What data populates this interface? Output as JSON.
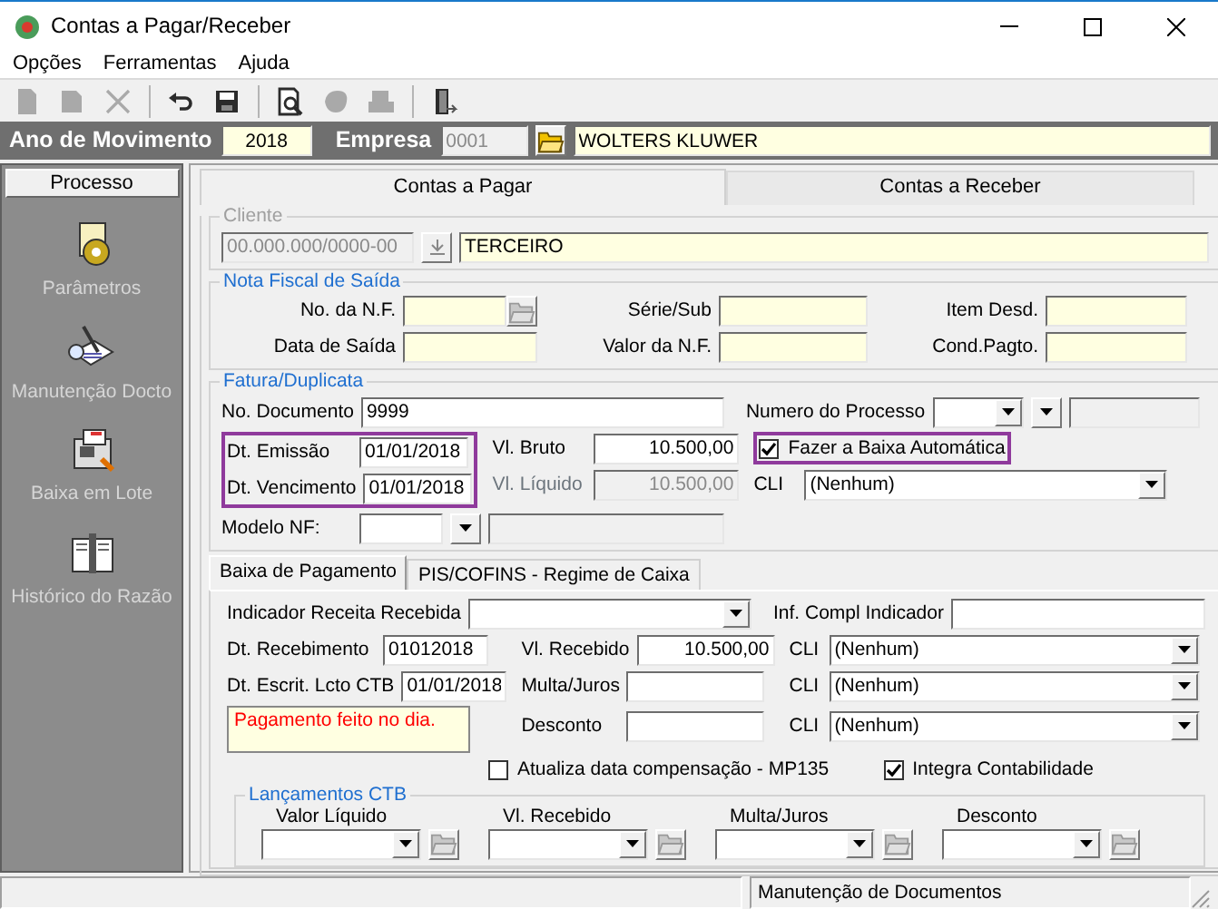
{
  "window": {
    "title": "Contas a Pagar/Receber"
  },
  "menu": [
    {
      "label": "Opções"
    },
    {
      "label": "Ferramentas"
    },
    {
      "label": "Ajuda"
    }
  ],
  "toolbar": [
    {
      "kind": "new",
      "disabled": true
    },
    {
      "kind": "edit",
      "disabled": true
    },
    {
      "kind": "delete",
      "disabled": true
    },
    {
      "kind": "undo",
      "disabled": false
    },
    {
      "kind": "save",
      "disabled": false
    },
    {
      "kind": "preview",
      "disabled": false
    },
    {
      "kind": "shape",
      "disabled": true
    },
    {
      "kind": "machine",
      "disabled": true
    },
    {
      "kind": "exit",
      "disabled": false
    }
  ],
  "header": {
    "year_label": "Ano de Movimento",
    "year": "2018",
    "company_label": "Empresa",
    "company_code": "0001",
    "company_name": "WOLTERS KLUWER"
  },
  "sidebar": {
    "title": "Processo",
    "items": [
      {
        "kind": "gear",
        "label": "Parâmetros"
      },
      {
        "kind": "pen",
        "label": "Manutenção Docto"
      },
      {
        "kind": "machine",
        "label": "Baixa em Lote"
      },
      {
        "kind": "book",
        "label": "Histórico do Razão"
      }
    ]
  },
  "tabs": [
    {
      "label": "Contas a Pagar",
      "selected": true
    },
    {
      "label": "Contas a Receber",
      "selected": false
    }
  ],
  "cliente": {
    "legend": "Cliente",
    "document": "00.000.000/0000-00",
    "document_disabled": true,
    "name": "TERCEIRO"
  },
  "nota_fiscal": {
    "legend": "Nota Fiscal de Saída",
    "fields": [
      {
        "label": "No. da N.F.",
        "lookup": true
      },
      {
        "label": "Série/Sub",
        "lookup": false
      },
      {
        "label": "Item Desd.",
        "lookup": false
      },
      {
        "label": "Data de Saída",
        "lookup": false
      },
      {
        "label": "Valor da N.F.",
        "lookup": false
      },
      {
        "label": "Cond.Pagto.",
        "lookup": false
      }
    ]
  },
  "fatura": {
    "legend": "Fatura/Duplicata",
    "no_documento": {
      "label": "No. Documento",
      "value": "9999"
    },
    "numero_processo": {
      "label": "Numero do Processo"
    },
    "dates_highlighted": true,
    "emissao": {
      "label": "Dt. Emissão",
      "value": "01/01/2018"
    },
    "vencimento": {
      "label": "Dt. Vencimento",
      "value": "01/01/2018"
    },
    "vl_bruto": {
      "label": "Vl. Bruto",
      "value": "10.500,00",
      "disabled": false
    },
    "vl_liquido": {
      "label": "Vl. Líquido",
      "value": "10.500,00",
      "disabled": true
    },
    "baixa_automatica": {
      "label": "Fazer a Baixa Automática",
      "checked": true,
      "highlighted": true
    },
    "cli": {
      "label": "CLI",
      "value": "(Nenhum)"
    },
    "modelo_nf": {
      "label": "Modelo NF:"
    }
  },
  "subtabs": [
    {
      "label": "Baixa de Pagamento",
      "selected": true
    },
    {
      "label": "PIS/COFINS - Regime de Caixa",
      "selected": false
    }
  ],
  "baixa": {
    "indicador": {
      "label": "Indicador Receita Recebida"
    },
    "inf_compl": {
      "label": "Inf. Compl Indicador"
    },
    "dates": [
      {
        "label": "Dt. Recebimento",
        "value": "01012018"
      },
      {
        "label": "Dt. Escrit. Lcto CTB",
        "value": "01/01/2018"
      }
    ],
    "amounts": [
      {
        "label": "Vl. Recebido",
        "value": "10.500,00"
      },
      {
        "label": "Multa/Juros"
      },
      {
        "label": "Desconto"
      }
    ],
    "cli": [
      {
        "label": "CLI",
        "value": "(Nenhum)"
      },
      {
        "label": "CLI",
        "value": "(Nenhum)"
      },
      {
        "label": "CLI",
        "value": "(Nenhum)"
      }
    ],
    "note": "Pagamento feito no dia.",
    "checks": [
      {
        "label": "Atualiza data compensação - MP135",
        "checked": false
      },
      {
        "label": "Integra Contabilidade",
        "checked": true
      }
    ],
    "lancamentos": {
      "legend": "Lançamentos CTB",
      "columns": [
        {
          "label": "Valor Líquido"
        },
        {
          "label": "Vl. Recebido"
        },
        {
          "label": "Multa/Juros"
        },
        {
          "label": "Desconto"
        }
      ]
    }
  },
  "status_bar": {
    "message": "Manutenção de Documentos"
  }
}
